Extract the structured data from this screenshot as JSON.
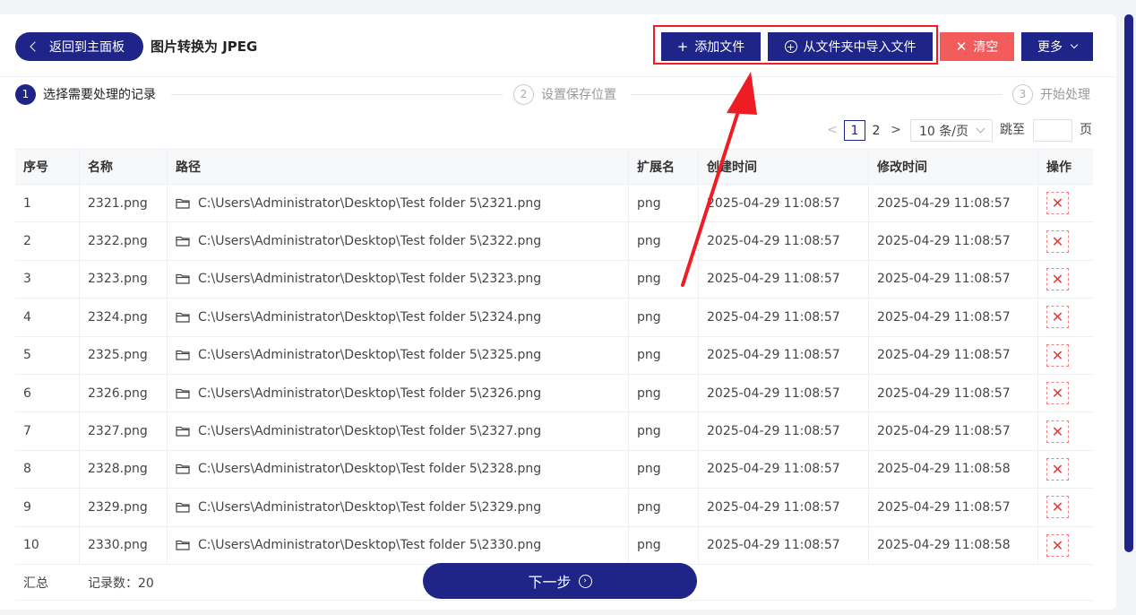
{
  "header": {
    "back_label": "返回到主面板",
    "title": "图片转换为 JPEG"
  },
  "toolbar": {
    "add_file": "添加文件",
    "import_folder": "从文件夹中导入文件",
    "clear": "清空",
    "more": "更多"
  },
  "steps": [
    {
      "num": "1",
      "label": "选择需要处理的记录"
    },
    {
      "num": "2",
      "label": "设置保存位置"
    },
    {
      "num": "3",
      "label": "开始处理"
    }
  ],
  "pager": {
    "prev": "<",
    "current": "1",
    "page2": "2",
    "next": ">",
    "page_size": "10 条/页",
    "jump_label": "跳至",
    "page_label": "页"
  },
  "table": {
    "headers": [
      "序号",
      "名称",
      "路径",
      "扩展名",
      "创建时间",
      "修改时间",
      "操作"
    ],
    "rows": [
      {
        "idx": "1",
        "name": "2321.png",
        "path": "C:\\Users\\Administrator\\Desktop\\Test folder 5\\2321.png",
        "ext": "png",
        "ctime": "2025-04-29 11:08:57",
        "mtime": "2025-04-29 11:08:57"
      },
      {
        "idx": "2",
        "name": "2322.png",
        "path": "C:\\Users\\Administrator\\Desktop\\Test folder 5\\2322.png",
        "ext": "png",
        "ctime": "2025-04-29 11:08:57",
        "mtime": "2025-04-29 11:08:57"
      },
      {
        "idx": "3",
        "name": "2323.png",
        "path": "C:\\Users\\Administrator\\Desktop\\Test folder 5\\2323.png",
        "ext": "png",
        "ctime": "2025-04-29 11:08:57",
        "mtime": "2025-04-29 11:08:57"
      },
      {
        "idx": "4",
        "name": "2324.png",
        "path": "C:\\Users\\Administrator\\Desktop\\Test folder 5\\2324.png",
        "ext": "png",
        "ctime": "2025-04-29 11:08:57",
        "mtime": "2025-04-29 11:08:57"
      },
      {
        "idx": "5",
        "name": "2325.png",
        "path": "C:\\Users\\Administrator\\Desktop\\Test folder 5\\2325.png",
        "ext": "png",
        "ctime": "2025-04-29 11:08:57",
        "mtime": "2025-04-29 11:08:57"
      },
      {
        "idx": "6",
        "name": "2326.png",
        "path": "C:\\Users\\Administrator\\Desktop\\Test folder 5\\2326.png",
        "ext": "png",
        "ctime": "2025-04-29 11:08:57",
        "mtime": "2025-04-29 11:08:57"
      },
      {
        "idx": "7",
        "name": "2327.png",
        "path": "C:\\Users\\Administrator\\Desktop\\Test folder 5\\2327.png",
        "ext": "png",
        "ctime": "2025-04-29 11:08:57",
        "mtime": "2025-04-29 11:08:57"
      },
      {
        "idx": "8",
        "name": "2328.png",
        "path": "C:\\Users\\Administrator\\Desktop\\Test folder 5\\2328.png",
        "ext": "png",
        "ctime": "2025-04-29 11:08:57",
        "mtime": "2025-04-29 11:08:58"
      },
      {
        "idx": "9",
        "name": "2329.png",
        "path": "C:\\Users\\Administrator\\Desktop\\Test folder 5\\2329.png",
        "ext": "png",
        "ctime": "2025-04-29 11:08:57",
        "mtime": "2025-04-29 11:08:57"
      },
      {
        "idx": "10",
        "name": "2330.png",
        "path": "C:\\Users\\Administrator\\Desktop\\Test folder 5\\2330.png",
        "ext": "png",
        "ctime": "2025-04-29 11:08:57",
        "mtime": "2025-04-29 11:08:58"
      }
    ],
    "summary_label": "汇总",
    "summary_count": "记录数：20"
  },
  "footer": {
    "next_label": "下一步"
  },
  "colors": {
    "primary": "#1e2488",
    "danger": "#f25c5c",
    "highlight": "#ee1c25"
  },
  "icons": {
    "back": "chevron-left-icon",
    "add": "plus-icon",
    "import": "circle-plus-icon",
    "clear": "close-icon",
    "more": "chevron-down-icon",
    "folder": "folder-icon",
    "delete": "close-icon",
    "next": "circle-arrow-right-icon"
  }
}
